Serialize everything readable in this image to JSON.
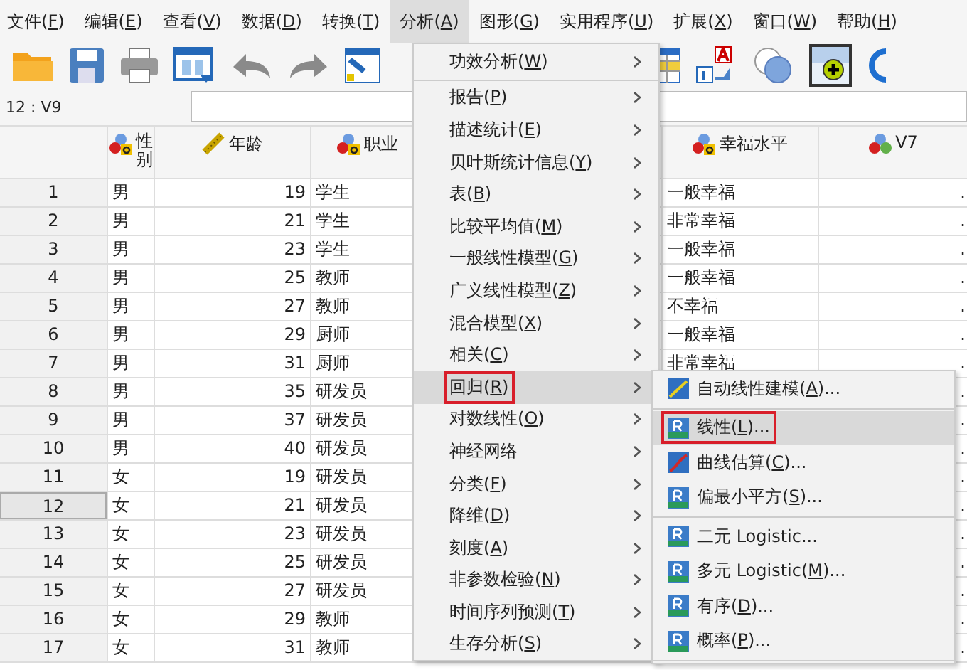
{
  "menu_bar": [
    {
      "label": "文件(F)",
      "selected": false
    },
    {
      "label": "编辑(E)",
      "selected": false
    },
    {
      "label": "查看(V)",
      "selected": false
    },
    {
      "label": "数据(D)",
      "selected": false
    },
    {
      "label": "转换(T)",
      "selected": false
    },
    {
      "label": "分析(A)",
      "selected": true
    },
    {
      "label": "图形(G)",
      "selected": false
    },
    {
      "label": "实用程序(U)",
      "selected": false
    },
    {
      "label": "扩展(X)",
      "selected": false
    },
    {
      "label": "窗口(W)",
      "selected": false
    },
    {
      "label": "帮助(H)",
      "selected": false
    }
  ],
  "cell_reference": "12 : V9",
  "columns": [
    {
      "name": "性别",
      "kind": "nominal"
    },
    {
      "name": "年龄",
      "kind": "scale"
    },
    {
      "name": "职业",
      "kind": "nominal"
    },
    {
      "name": "幸福水平",
      "kind": "nominal"
    },
    {
      "name": "V7",
      "kind": "multi"
    }
  ],
  "rows": [
    {
      "number": "1",
      "selected": false,
      "cells": [
        "男",
        "19",
        "学生",
        "一般幸福",
        "."
      ]
    },
    {
      "number": "2",
      "selected": false,
      "cells": [
        "男",
        "21",
        "学生",
        "非常幸福",
        "."
      ]
    },
    {
      "number": "3",
      "selected": false,
      "cells": [
        "男",
        "23",
        "学生",
        "一般幸福",
        "."
      ]
    },
    {
      "number": "4",
      "selected": false,
      "cells": [
        "男",
        "25",
        "教师",
        "一般幸福",
        "."
      ]
    },
    {
      "number": "5",
      "selected": false,
      "cells": [
        "男",
        "27",
        "教师",
        "不幸福",
        "."
      ]
    },
    {
      "number": "6",
      "selected": false,
      "cells": [
        "男",
        "29",
        "厨师",
        "一般幸福",
        "."
      ]
    },
    {
      "number": "7",
      "selected": false,
      "cells": [
        "男",
        "31",
        "厨师",
        "非常幸福",
        "."
      ]
    },
    {
      "number": "8",
      "selected": false,
      "cells": [
        "男",
        "35",
        "研发员",
        "",
        "."
      ]
    },
    {
      "number": "9",
      "selected": false,
      "cells": [
        "男",
        "37",
        "研发员",
        "",
        "."
      ]
    },
    {
      "number": "10",
      "selected": false,
      "cells": [
        "男",
        "40",
        "研发员",
        "",
        "."
      ]
    },
    {
      "number": "11",
      "selected": false,
      "cells": [
        "女",
        "19",
        "研发员",
        "",
        "."
      ]
    },
    {
      "number": "12",
      "selected": true,
      "cells": [
        "女",
        "21",
        "研发员",
        "",
        "."
      ]
    },
    {
      "number": "13",
      "selected": false,
      "cells": [
        "女",
        "23",
        "研发员",
        "",
        "."
      ]
    },
    {
      "number": "14",
      "selected": false,
      "cells": [
        "女",
        "25",
        "研发员",
        "",
        "."
      ]
    },
    {
      "number": "15",
      "selected": false,
      "cells": [
        "女",
        "27",
        "研发员",
        "",
        "."
      ]
    },
    {
      "number": "16",
      "selected": false,
      "cells": [
        "女",
        "29",
        "教师",
        "",
        "."
      ]
    },
    {
      "number": "17",
      "selected": false,
      "cells": [
        "女",
        "31",
        "教师",
        "",
        "."
      ]
    }
  ],
  "analyze_menu": [
    {
      "label": "功效分析(W)",
      "selected": false,
      "boxed": false,
      "separator_after": true
    },
    {
      "label": "报告(P)",
      "selected": false,
      "boxed": false,
      "separator_after": false
    },
    {
      "label": "描述统计(E)",
      "selected": false,
      "boxed": false,
      "separator_after": false
    },
    {
      "label": "贝叶斯统计信息(Y)",
      "selected": false,
      "boxed": false,
      "separator_after": false
    },
    {
      "label": "表(B)",
      "selected": false,
      "boxed": false,
      "separator_after": false
    },
    {
      "label": "比较平均值(M)",
      "selected": false,
      "boxed": false,
      "separator_after": false
    },
    {
      "label": "一般线性模型(G)",
      "selected": false,
      "boxed": false,
      "separator_after": false
    },
    {
      "label": "广义线性模型(Z)",
      "selected": false,
      "boxed": false,
      "separator_after": false
    },
    {
      "label": "混合模型(X)",
      "selected": false,
      "boxed": false,
      "separator_after": false
    },
    {
      "label": "相关(C)",
      "selected": false,
      "boxed": false,
      "separator_after": false
    },
    {
      "label": "回归(R)",
      "selected": true,
      "boxed": true,
      "separator_after": false
    },
    {
      "label": "对数线性(O)",
      "selected": false,
      "boxed": false,
      "separator_after": false
    },
    {
      "label": "神经网络",
      "selected": false,
      "boxed": false,
      "separator_after": false
    },
    {
      "label": "分类(F)",
      "selected": false,
      "boxed": false,
      "separator_after": false
    },
    {
      "label": "降维(D)",
      "selected": false,
      "boxed": false,
      "separator_after": false
    },
    {
      "label": "刻度(A)",
      "selected": false,
      "boxed": false,
      "separator_after": false
    },
    {
      "label": "非参数检验(N)",
      "selected": false,
      "boxed": false,
      "separator_after": false
    },
    {
      "label": "时间序列预测(T)",
      "selected": false,
      "boxed": false,
      "separator_after": false
    },
    {
      "label": "生存分析(S)",
      "selected": false,
      "boxed": false,
      "separator_after": false
    }
  ],
  "regression_menu": [
    {
      "label": "自动线性建模(A)...",
      "kind": "auto",
      "selected": false,
      "boxed": false,
      "separator_after": true
    },
    {
      "label": "线性(L)...",
      "kind": "r",
      "selected": true,
      "boxed": true,
      "separator_after": false
    },
    {
      "label": "曲线估算(C)...",
      "kind": "curve",
      "selected": false,
      "boxed": false,
      "separator_after": false
    },
    {
      "label": "偏最小平方(S)...",
      "kind": "r",
      "selected": false,
      "boxed": false,
      "separator_after": true
    },
    {
      "label": "二元 Logistic...",
      "kind": "r",
      "selected": false,
      "boxed": false,
      "separator_after": false
    },
    {
      "label": "多元 Logistic(M)...",
      "kind": "r",
      "selected": false,
      "boxed": false,
      "separator_after": false
    },
    {
      "label": "有序(D)...",
      "kind": "r",
      "selected": false,
      "boxed": false,
      "separator_after": false
    },
    {
      "label": "概率(P)...",
      "kind": "r",
      "selected": false,
      "boxed": false,
      "separator_after": true
    }
  ]
}
